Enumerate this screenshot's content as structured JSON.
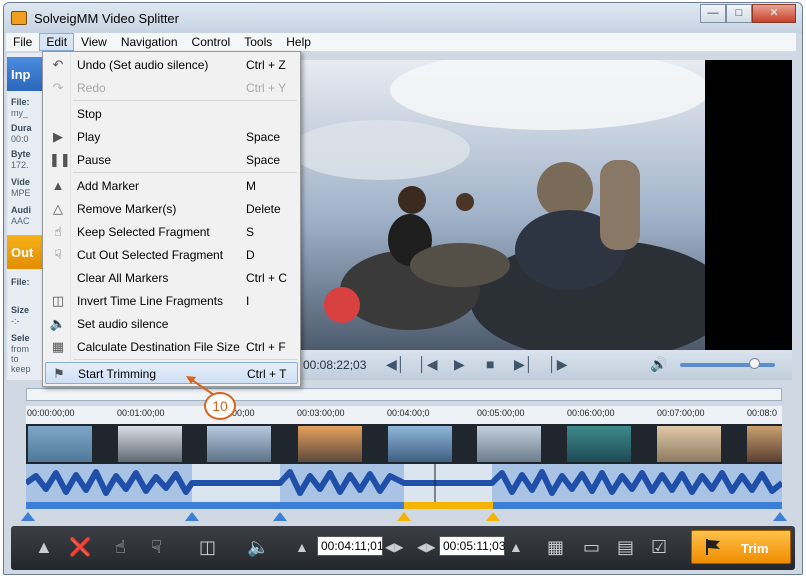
{
  "window": {
    "title": "SolveigMM Video Splitter"
  },
  "menubar": [
    "File",
    "Edit",
    "View",
    "Navigation",
    "Control",
    "Tools",
    "Help"
  ],
  "left_panel": {
    "input_label": "Inp",
    "output_label": "Out",
    "input_rows": [
      "File:",
      "my_",
      "Dura",
      "00:0",
      "Byte",
      "172.",
      "Vide",
      "MPE",
      "Audi",
      "AAC"
    ],
    "output_rows": [
      "File:",
      "Size",
      "-:-",
      "Sele",
      "from",
      "to",
      "keep"
    ]
  },
  "edit_menu": [
    {
      "icon": "undo-icon",
      "label": "Undo (Set audio silence)",
      "shortcut": "Ctrl + Z",
      "enabled": true
    },
    {
      "icon": "redo-icon",
      "label": "Redo",
      "shortcut": "Ctrl + Y",
      "enabled": false
    },
    {
      "icon": "",
      "label": "Stop",
      "shortcut": "",
      "enabled": true
    },
    {
      "icon": "play-icon",
      "label": "Play",
      "shortcut": "Space",
      "enabled": true
    },
    {
      "icon": "pause-icon",
      "label": "Pause",
      "shortcut": "Space",
      "enabled": true
    },
    {
      "icon": "add-marker-icon",
      "label": "Add Marker",
      "shortcut": "M",
      "enabled": true
    },
    {
      "icon": "remove-marker-icon",
      "label": "Remove Marker(s)",
      "shortcut": "Delete",
      "enabled": true
    },
    {
      "icon": "thumbs-up-icon",
      "label": "Keep Selected Fragment",
      "shortcut": "S",
      "enabled": true
    },
    {
      "icon": "thumbs-down-icon",
      "label": "Cut Out Selected Fragment",
      "shortcut": "D",
      "enabled": true
    },
    {
      "icon": "",
      "label": "Clear All Markers",
      "shortcut": "Ctrl + C",
      "enabled": true
    },
    {
      "icon": "invert-icon",
      "label": "Invert Time Line Fragments",
      "shortcut": "I",
      "enabled": true
    },
    {
      "icon": "mute-icon",
      "label": "Set audio silence",
      "shortcut": "",
      "enabled": true
    },
    {
      "icon": "film-icon",
      "label": "Calculate Destination File Size",
      "shortcut": "Ctrl + F",
      "enabled": true
    },
    {
      "icon": "flag-icon",
      "label": "Start Trimming",
      "shortcut": "Ctrl + T",
      "enabled": true
    }
  ],
  "player": {
    "timecode": "00:08:22;03",
    "volume": 0.82
  },
  "timeline": {
    "ticks": [
      "00:00:00;00",
      "00:01:00;00",
      "00:02:00;00",
      "00:03:00;00",
      "00:04:00;0",
      "00:05:00;00",
      "00:06:00;00",
      "00:07:00;00",
      "00:08:0"
    ]
  },
  "toolbar": {
    "start_time": "00:04:11;01",
    "end_time": "00:05:11;03",
    "trim_label": "Trim"
  },
  "callout": {
    "step": "10"
  }
}
